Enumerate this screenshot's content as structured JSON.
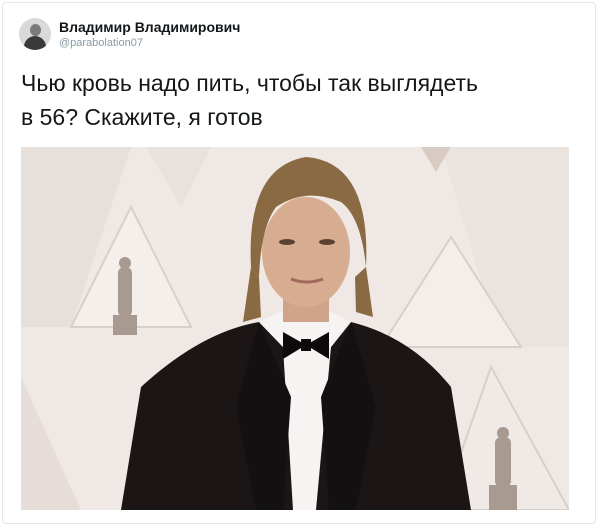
{
  "tweet": {
    "author_name": "Владимир Владимирович",
    "author_handle": "@parabolation07",
    "text_line1": "Чью кровь надо пить, чтобы так выглядеть",
    "text_line2": "в 56? Скажите, я готов"
  },
  "icons": {
    "avatar": "user-avatar"
  },
  "colors": {
    "name": "#14171a",
    "handle": "#8899a6",
    "border": "#e1e8ed"
  }
}
